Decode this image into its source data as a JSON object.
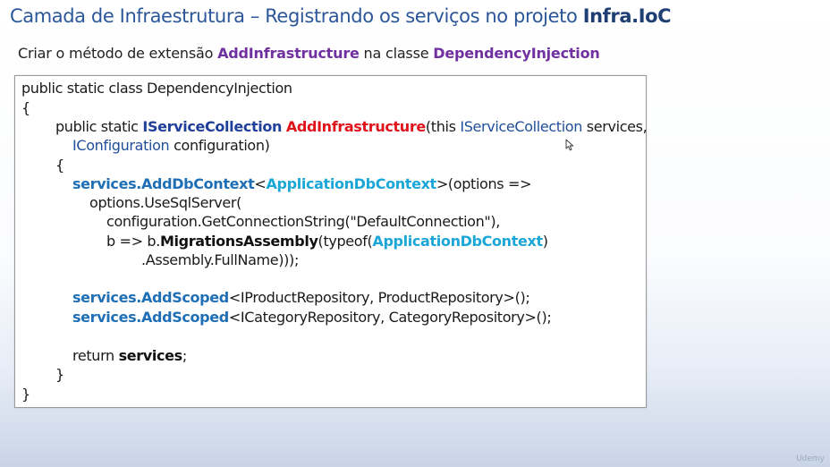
{
  "slide": {
    "title_main": "Camada de Infraestrutura – Registrando os serviços no projeto ",
    "title_bold": "Infra.IoC",
    "subtitle_pre": "Criar o método de extensão ",
    "subtitle_method": "AddInfrastructure",
    "subtitle_mid": " na classe ",
    "subtitle_class": "DependencyInjection"
  },
  "code": {
    "l1": "public static class DependencyInjection",
    "l2": "{",
    "l3_a": "public static ",
    "l3_b": "IServiceCollection",
    "l3_c": " ",
    "l3_d": "AddInfrastructure",
    "l3_e": "(this ",
    "l3_f": "IServiceCollection",
    "l3_g": " services,",
    "l4_a": "IConfiguration",
    "l4_b": " configuration)",
    "l5": "{",
    "l6_a": "services.AddDbContext",
    "l6_b": "<",
    "l6_c": "ApplicationDbContext",
    "l6_d": ">(options =>",
    "l7": "options.UseSqlServer(",
    "l8": "configuration.GetConnectionString(\"DefaultConnection\"),",
    "l9_a": "b => b.",
    "l9_b": "MigrationsAssembly",
    "l9_c": "(typeof(",
    "l9_d": "ApplicationDbContext",
    "l9_e": ")",
    "l10": ".Assembly.FullName)));",
    "l11_a": "services.AddScoped",
    "l11_b": "<IProductRepository, ProductRepository>();",
    "l12_a": "services.AddScoped",
    "l12_b": "<ICategoryRepository, CategoryRepository>();",
    "l13_a": "return ",
    "l13_b": "services",
    "l13_c": ";",
    "l14": "}",
    "l15": "}"
  },
  "colors": {
    "title": "#2b579a",
    "purple": "#7030a0",
    "method_red": "#e0131b",
    "services_blue": "#1f6fb6",
    "type_cyan": "#1aa7d8"
  },
  "icons": {
    "cursor": "mouse-pointer-icon"
  },
  "watermark": "Udemy"
}
